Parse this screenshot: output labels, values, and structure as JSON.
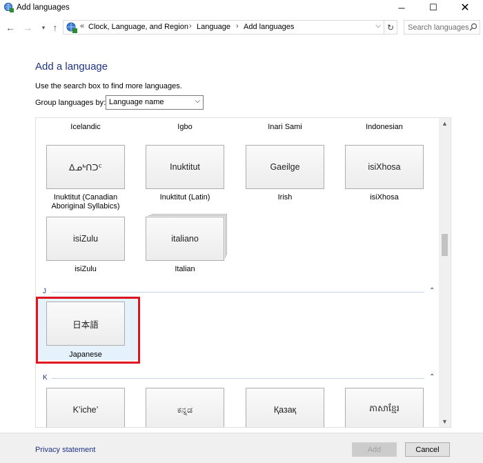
{
  "window": {
    "title": "Add languages"
  },
  "address": {
    "prefix": "«",
    "crumbs": [
      "Clock, Language, and Region",
      "Language",
      "Add languages"
    ]
  },
  "search": {
    "placeholder": "Search languages"
  },
  "page": {
    "heading": "Add a language",
    "hint": "Use the search box to find more languages.",
    "group_label": "Group languages by:",
    "group_value": "Language name"
  },
  "languages": {
    "headers": [
      "Icelandic",
      "Igbo",
      "Inari Sami",
      "Indonesian"
    ],
    "row1": [
      {
        "tile": "ᐃᓄᒃᑎᑐᑦ",
        "label": "Inuktitut (Canadian Aboriginal Syllabics)"
      },
      {
        "tile": "Inuktitut",
        "label": "Inuktitut (Latin)"
      },
      {
        "tile": "Gaeilge",
        "label": "Irish"
      },
      {
        "tile": "isiXhosa",
        "label": "isiXhosa"
      }
    ],
    "row2": [
      {
        "tile": "isiZulu",
        "label": "isiZulu"
      },
      {
        "tile": "italiano",
        "label": "Italian"
      }
    ],
    "section_j": "J",
    "japanese": {
      "tile": "日本語",
      "label": "Japanese"
    },
    "section_k": "K",
    "row_k": [
      "K’iche’",
      "ಕನ್ನಡ",
      "Қазақ",
      "ភាសាខ្មែរ"
    ]
  },
  "footer": {
    "privacy": "Privacy statement",
    "add": "Add",
    "cancel": "Cancel"
  }
}
